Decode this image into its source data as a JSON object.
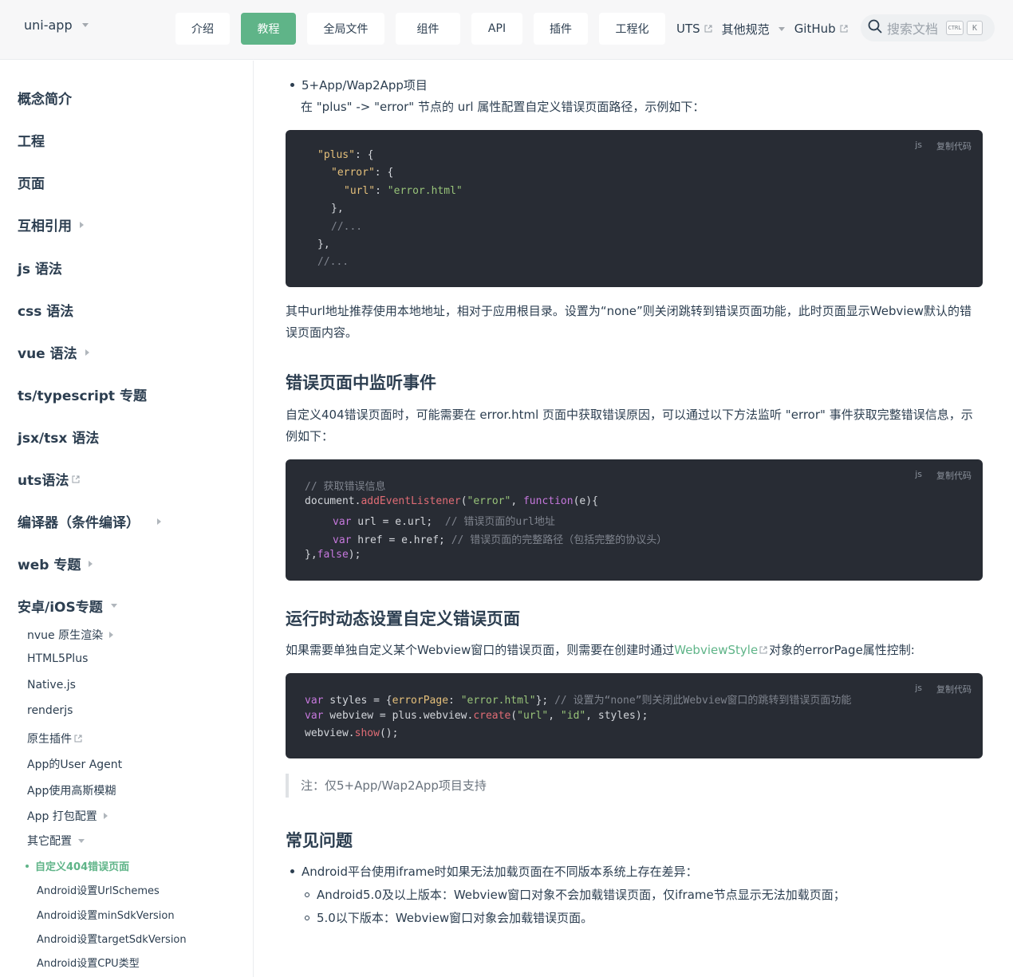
{
  "header": {
    "brand": "uni-app",
    "nav": [
      {
        "label": "介绍",
        "active": false
      },
      {
        "label": "教程",
        "active": true
      },
      {
        "label": "全局文件",
        "active": false
      },
      {
        "label": "组件",
        "active": false
      },
      {
        "label": "API",
        "active": false
      },
      {
        "label": "插件",
        "active": false
      },
      {
        "label": "工程化",
        "active": false
      }
    ],
    "links": {
      "uts": "UTS",
      "other": "其他规范",
      "github": "GitHub"
    },
    "search_placeholder": "搜索文档",
    "kbd_ctrl": "CTRL",
    "kbd_k": "K",
    "accent": "#5fb488"
  },
  "sidebar": {
    "top": [
      "概念简介",
      "工程",
      "页面",
      "互相引用",
      "js 语法",
      "css 语法",
      "vue 语法",
      "ts/typescript 专题",
      "jsx/tsx 语法",
      "uts语法",
      "编译器（条件编译）",
      "web 专题",
      "安卓/iOS专题"
    ],
    "sub": [
      "nvue 原生渲染",
      "HTML5Plus",
      "Native.js",
      "renderjs",
      "原生插件",
      "App的User Agent",
      "App使用高斯模糊",
      "App 打包配置",
      "其它配置"
    ],
    "active": "自定义404错误页面",
    "sub2": [
      "Android设置UrlSchemes",
      "Android设置minSdkVersion",
      "Android设置targetSdkVersion",
      "Android设置CPU类型"
    ]
  },
  "content": {
    "bullet1": "5+App/Wap2App项目",
    "bullet1_desc": "在 \"plus\" -> \"error\" 节点的 url 属性配置自定义错误页面路径，示例如下：",
    "code_lang": "js",
    "code_copy": "复制代码",
    "code1": {
      "plus_key": "\"plus\"",
      "error_key": "\"error\"",
      "url_key": "\"url\"",
      "url_val": "\"error.html\"",
      "open_brace": ": {",
      "colon": ": ",
      "close1": "},",
      "comment": "//...",
      "close2": "},"
    },
    "p1": "其中url地址推荐使用本地地址，相对于应用根目录。设置为“none”则关闭跳转到错误页面功能，此时页面显示Webview默认的错误页面内容。",
    "h_listen": "错误页面中监听事件",
    "p2": "自定义404错误页面时，可能需要在 error.html 页面中获取错误原因，可以通过以下方法监听 \"error\" 事件获取完整错误信息，示例如下：",
    "code2": {
      "l1": "// 获取错误信息",
      "doc": "document.",
      "ael": "addEventListener",
      "open": "(",
      "err_str": "\"error\"",
      "comma": ", ",
      "func": "function",
      "args": "(e){",
      "var": "var",
      "url_decl": " url = e.url;",
      "url_comment": "  // 错误页面的url地址",
      "href_decl": " href = e.href;",
      "href_comment": " // 错误页面的完整路径（包括完整的协议头）",
      "close": "},",
      "false_kw": "false",
      "end": ");"
    },
    "h_runtime": "运行时动态设置自定义错误页面",
    "p3_pre": "如果需要单独自定义某个Webview窗口的错误页面，则需要在创建时通过",
    "p3_link": "WebviewStyle",
    "p3_post": "对象的errorPage属性控制:",
    "code3": {
      "var": "var",
      "styles": " styles = {",
      "ep": "errorPage",
      "colon": ": ",
      "val": "\"error.html\"",
      "close": "};",
      "comment": " // 设置为“none”则关闭此Webview窗口的跳转到错误页面功能",
      "wv": " webview = plus.webview.",
      "create": "create",
      "args_open": "(",
      "a1": "\"url\"",
      "comma": ", ",
      "a2": "\"id\"",
      "args_close": ", styles);",
      "show_pre": "webview.",
      "show": "show",
      "show_end": "();"
    },
    "note": "注：仅5+App/Wap2App项目支持",
    "h_faq": "常见问题",
    "faq1": "Android平台使用iframe时如果无法加载页面在不同版本系统上存在差异：",
    "faq1a": "Android5.0及以上版本：Webview窗口对象不会加载错误页面，仅iframe节点显示无法加载页面；",
    "faq1b": "5.0以下版本：Webview窗口对象会加载错误页面。"
  }
}
